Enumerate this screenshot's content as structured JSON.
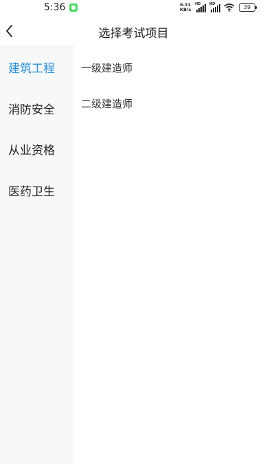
{
  "status_bar": {
    "time": "5:36",
    "net_speed_value": "6.31",
    "net_speed_unit": "KB/s",
    "signal_1_label": "HD",
    "signal_2_label": "HD",
    "battery": "39"
  },
  "header": {
    "title": "选择考试项目"
  },
  "sidebar": {
    "items": [
      {
        "label": "建筑工程",
        "active": true
      },
      {
        "label": "消防安全",
        "active": false
      },
      {
        "label": "从业资格",
        "active": false
      },
      {
        "label": "医药卫生",
        "active": false
      }
    ]
  },
  "content": {
    "items": [
      {
        "label": "一级建造师"
      },
      {
        "label": "二级建造师"
      }
    ]
  },
  "colors": {
    "accent": "#2a8fd8",
    "sidebar_bg": "#f7f8fa"
  }
}
